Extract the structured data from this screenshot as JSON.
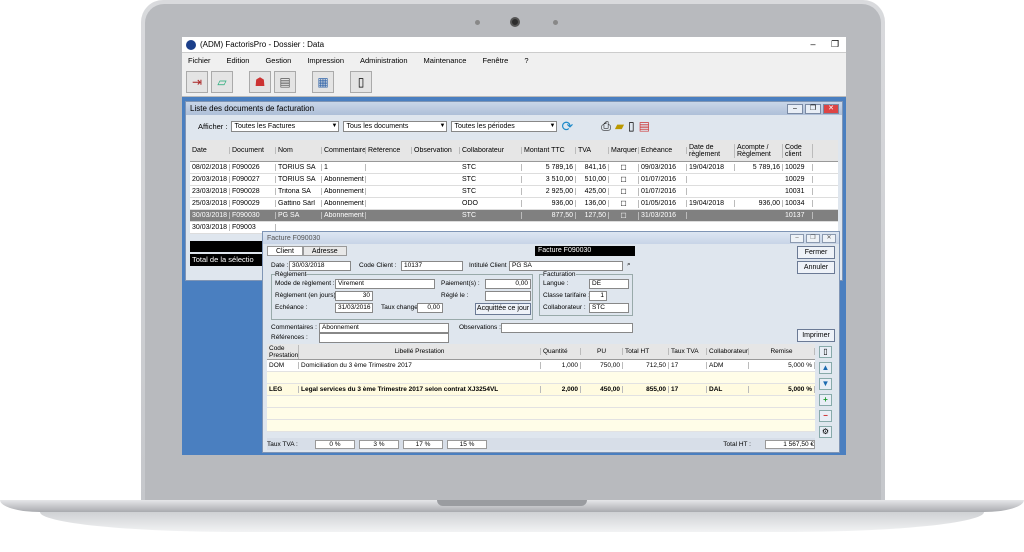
{
  "app": {
    "title": "(ADM) FactorisPro - Dossier : Data"
  },
  "menu": [
    "Fichier",
    "Edition",
    "Gestion",
    "Impression",
    "Administration",
    "Maintenance",
    "Fenêtre",
    "?"
  ],
  "list": {
    "title": "Liste des documents de facturation",
    "filter_label": "Afficher :",
    "filter1": "Toutes les Factures",
    "filter2": "Tous les documents",
    "filter3": "Toutes les périodes",
    "headers": [
      "Date",
      "Document",
      "Nom",
      "Commentaire",
      "Référence",
      "Observation",
      "Collaborateur",
      "Montant TTC",
      "TVA",
      "Marquer",
      "Echéance",
      "Date de règlement",
      "Acompte / Règlement",
      "Code client"
    ],
    "rows": [
      [
        "08/02/2018",
        "F090026",
        "TORIUS SA",
        "1",
        "",
        "",
        "STC",
        "5 789,16",
        "841,16",
        "",
        "09/03/2016",
        "19/04/2018",
        "5 789,16",
        "10029"
      ],
      [
        "20/03/2018",
        "F090027",
        "TORIUS SA",
        "Abonnement",
        "",
        "",
        "STC",
        "3 510,00",
        "510,00",
        "",
        "01/07/2016",
        "",
        "",
        "10029"
      ],
      [
        "23/03/2018",
        "F090028",
        "Tritona SA",
        "Abonnement",
        "",
        "",
        "STC",
        "2 925,00",
        "425,00",
        "",
        "01/07/2016",
        "",
        "",
        "10031"
      ],
      [
        "25/03/2018",
        "F090029",
        "Gattino Sàrl",
        "Abonnement",
        "",
        "",
        "ODO",
        "936,00",
        "136,00",
        "",
        "01/05/2016",
        "19/04/2018",
        "936,00",
        "10034"
      ],
      [
        "30/03/2018",
        "F090030",
        "PG SA",
        "Abonnement",
        "",
        "",
        "STC",
        "877,50",
        "127,50",
        "",
        "31/03/2016",
        "",
        "",
        "10137"
      ],
      [
        "30/03/2018",
        "F09003",
        "",
        "",
        "",
        "",
        "",
        "",
        "",
        "",
        "",
        "",
        "",
        ""
      ]
    ],
    "total_label": "Total de la sélectio"
  },
  "dialog": {
    "title": "Facture F090030",
    "tab_client": "Client",
    "tab_adresse": "Adresse",
    "facture_label": "Facture F090030",
    "fermer": "Fermer",
    "annuler": "Annuler",
    "imprimer": "Imprimer",
    "date_label": "Date :",
    "date": "30/03/2018",
    "code_client_label": "Code Client :",
    "code_client": "10137",
    "intitule_label": "Intitulé Client :",
    "intitule": "PG SA",
    "reglement_group": "Règlement",
    "facturation_group": "Facturation",
    "mode_label": "Mode de règlement :",
    "mode": "Virement",
    "paiement_label": "Paiement(s) :",
    "paiement": "0,00",
    "reglement_jours_label": "Règlement (en jours) :",
    "reglement_jours": "30",
    "regle_label": "Réglé le :",
    "regle": "",
    "echeance_label": "Echéance :",
    "echeance": "31/03/2016",
    "taux_label": "Taux change :",
    "taux": "0,00",
    "acquittee": "Acquittée ce jour",
    "langue_label": "Langue :",
    "langue": "DE",
    "classe_label": "Classe tarifaire :",
    "classe": "1",
    "collab_label": "Collaborateur :",
    "collab": "STC",
    "commentaires_label": "Commentaires :",
    "commentaires": "Abonnement",
    "observations_label": "Observations :",
    "references_label": "Références :",
    "grid_headers": [
      "Code Prestation",
      "Libellé Prestation",
      "Quantité",
      "PU",
      "Total HT",
      "Taux TVA",
      "Collaborateur",
      "Remise"
    ],
    "grid_rows": [
      [
        "DOM",
        "Domiciliation du 3 ème Trimestre 2017",
        "1,000",
        "750,00",
        "712,50",
        "17",
        "ADM",
        "5,000 %"
      ],
      [
        "LEG",
        "Legal services du 3 ème Trimestre 2017 selon contrat XJ3254VL",
        "2,000",
        "450,00",
        "855,00",
        "17",
        "DAL",
        "5,000 %"
      ]
    ],
    "taux_tva_label": "Taux TVA :",
    "tva_rates": [
      "0 %",
      "3 %",
      "17 %",
      "15 %"
    ],
    "total_ht_label": "Total HT :",
    "total_ht": "1 567,50 €"
  }
}
